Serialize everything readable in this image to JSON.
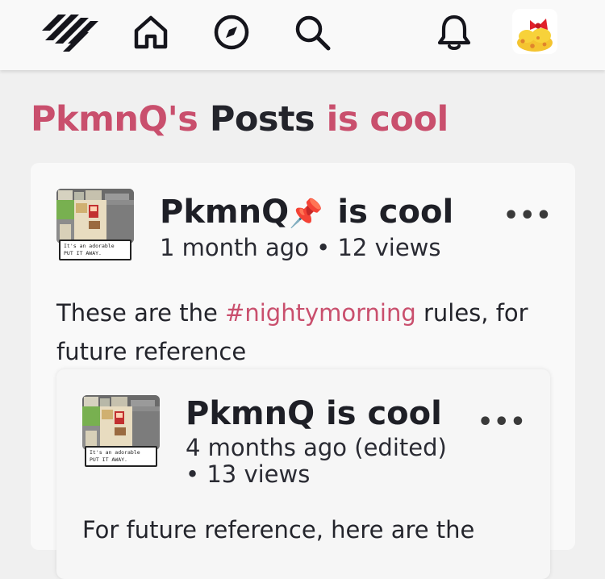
{
  "nav": {
    "logo": "logo-icon",
    "items": [
      "home-icon",
      "explore-icon",
      "search-icon",
      "notifications-icon"
    ],
    "avatar": "user-avatar"
  },
  "page_title": {
    "username": "PkmnQ's",
    "word": "Posts",
    "suffix": "is cool"
  },
  "post": {
    "author": "PkmnQ",
    "pin_icon": "📌",
    "author_suffix": "is cool",
    "meta": "1 month ago • 12 views",
    "more": "•••",
    "thumb_caption_1": "It's an adorable",
    "thumb_caption_2": "PUT IT AWAY.",
    "body_prefix": "These are the ",
    "hashtag": "#nightymorning",
    "body_suffix": " rules, for future reference",
    "quoted": {
      "author": "PkmnQ is cool",
      "meta_line1": "4 months ago (edited)",
      "meta_line2": "• 13 views",
      "more": "•••",
      "thumb_caption_1": "It's an adorable",
      "thumb_caption_2": "PUT IT AWAY.",
      "body": "For future reference, here are the"
    }
  }
}
